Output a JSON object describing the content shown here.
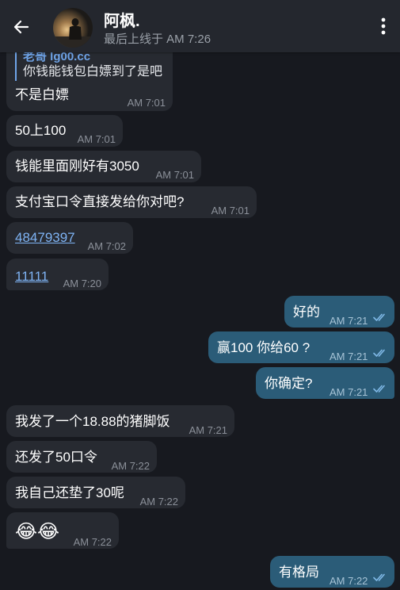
{
  "header": {
    "title": "阿枫.",
    "subtitle": "最后上线于 AM 7:26"
  },
  "messages": [
    {
      "dir": "in",
      "reply_name": "老哥 lg00.cc",
      "reply_text": "你钱能钱包白嫖到了是吧",
      "text": "不是白嫖",
      "time": "AM 7:01"
    },
    {
      "dir": "in",
      "text": "50上100",
      "time": "AM 7:01"
    },
    {
      "dir": "in",
      "text": "钱能里面刚好有3050",
      "time": "AM 7:01"
    },
    {
      "dir": "in",
      "text": "支付宝口令直接发给你对吧?",
      "time": "AM 7:01"
    },
    {
      "dir": "in",
      "text": "48479397",
      "time": "AM 7:02",
      "link": true
    },
    {
      "dir": "in",
      "text": "11111",
      "time": "AM 7:20",
      "link": true
    },
    {
      "dir": "out",
      "text": "好的",
      "time": "AM 7:21",
      "read": true
    },
    {
      "dir": "out",
      "text": "赢100 你给60 ?",
      "time": "AM 7:21",
      "read": true
    },
    {
      "dir": "out",
      "text": "你确定?",
      "time": "AM 7:21",
      "read": true
    },
    {
      "dir": "in",
      "text": "我发了一个18.88的猪脚饭",
      "time": "AM 7:21"
    },
    {
      "dir": "in",
      "text": "还发了50口令",
      "time": "AM 7:22"
    },
    {
      "dir": "in",
      "text": "我自己还垫了30呢",
      "time": "AM 7:22"
    },
    {
      "dir": "in",
      "text": "😂😂",
      "time": "AM 7:22"
    },
    {
      "dir": "out",
      "text": "有格局",
      "time": "AM 7:22",
      "read": true
    }
  ],
  "colors": {
    "background": "#17191f",
    "header": "#24272e",
    "incoming_bubble": "#272a31",
    "outgoing_bubble": "#2b5c78",
    "link": "#7fb4f5",
    "read_ticks": "#7fb8e6"
  },
  "icons": {
    "back": "arrow-left-icon",
    "menu": "more-vertical-icon",
    "read_receipt": "double-check-icon"
  }
}
